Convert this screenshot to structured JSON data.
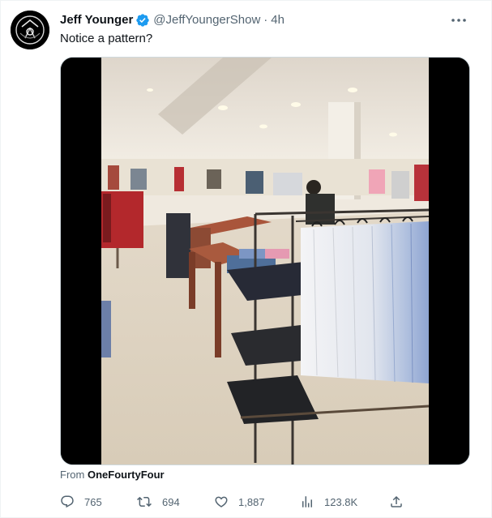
{
  "author": {
    "name": "Jeff Younger",
    "handle": "@JeffYoungerShow",
    "separator": "·",
    "time": "4h",
    "verified": true
  },
  "tweet": {
    "text": "Notice a pattern?"
  },
  "media": {
    "type": "video",
    "from_prefix": "From",
    "from_source": "OneFourtyFour"
  },
  "actions": {
    "replies": "765",
    "retweets": "694",
    "likes": "1,887",
    "views": "123.8K"
  },
  "colors": {
    "text_primary": "#0f1419",
    "text_secondary": "#536471",
    "verified_blue": "#1d9bf0",
    "border": "#cfd9de"
  },
  "icons": {
    "verified": "verified-badge-icon",
    "more": "more-dots-icon",
    "reply": "reply-icon",
    "retweet": "retweet-icon",
    "like": "heart-icon",
    "views": "views-bar-chart-icon",
    "share": "share-icon"
  }
}
